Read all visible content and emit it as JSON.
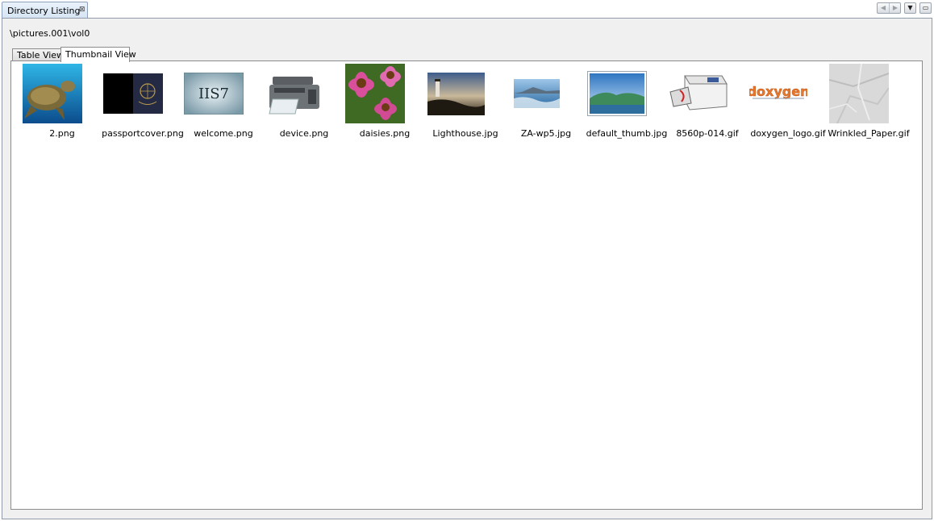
{
  "window": {
    "tab_title": "Directory Listing",
    "close_glyph": "⊠",
    "nav_left": "◀",
    "nav_right": "▶",
    "menu_glyph": "▼",
    "maximize_glyph": "▭"
  },
  "path": "\\pictures.001\\vol0",
  "tabs": [
    "Table View",
    "Thumbnail View"
  ],
  "active_tab": "Thumbnail View",
  "files": [
    {
      "name": "2.png",
      "icon": "sea-turtle-thumbnail"
    },
    {
      "name": "passportcover.png",
      "icon": "passport-cover-thumbnail"
    },
    {
      "name": "welcome.png",
      "icon": "iis7-welcome-thumbnail"
    },
    {
      "name": "device.png",
      "icon": "printer-device-thumbnail"
    },
    {
      "name": "daisies.png",
      "icon": "daisies-thumbnail"
    },
    {
      "name": "Lighthouse.jpg",
      "icon": "lighthouse-thumbnail"
    },
    {
      "name": "ZA-wp5.jpg",
      "icon": "seascape-thumbnail"
    },
    {
      "name": "default_thumb.jpg",
      "icon": "landscape-thumbnail"
    },
    {
      "name": "8560p-014.gif",
      "icon": "laser-printer-thumbnail"
    },
    {
      "name": "doxygen_logo.gif",
      "icon": "doxygen-logo-thumbnail"
    },
    {
      "name": "Wrinkled_Paper.gif",
      "icon": "wrinkled-paper-thumbnail"
    }
  ],
  "thumb_text": {
    "welcome": "IIS7",
    "doxygen": "doxygen"
  }
}
